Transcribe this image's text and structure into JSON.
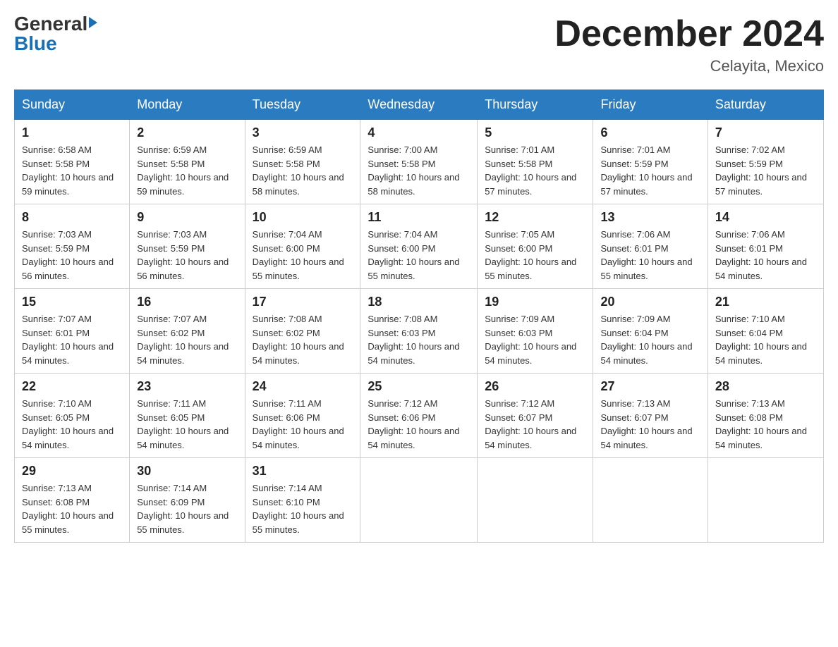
{
  "logo": {
    "general": "General",
    "blue": "Blue"
  },
  "title": {
    "month": "December 2024",
    "location": "Celayita, Mexico"
  },
  "weekdays": [
    "Sunday",
    "Monday",
    "Tuesday",
    "Wednesday",
    "Thursday",
    "Friday",
    "Saturday"
  ],
  "weeks": [
    [
      {
        "day": "1",
        "sunrise": "6:58 AM",
        "sunset": "5:58 PM",
        "daylight": "10 hours and 59 minutes."
      },
      {
        "day": "2",
        "sunrise": "6:59 AM",
        "sunset": "5:58 PM",
        "daylight": "10 hours and 59 minutes."
      },
      {
        "day": "3",
        "sunrise": "6:59 AM",
        "sunset": "5:58 PM",
        "daylight": "10 hours and 58 minutes."
      },
      {
        "day": "4",
        "sunrise": "7:00 AM",
        "sunset": "5:58 PM",
        "daylight": "10 hours and 58 minutes."
      },
      {
        "day": "5",
        "sunrise": "7:01 AM",
        "sunset": "5:58 PM",
        "daylight": "10 hours and 57 minutes."
      },
      {
        "day": "6",
        "sunrise": "7:01 AM",
        "sunset": "5:59 PM",
        "daylight": "10 hours and 57 minutes."
      },
      {
        "day": "7",
        "sunrise": "7:02 AM",
        "sunset": "5:59 PM",
        "daylight": "10 hours and 57 minutes."
      }
    ],
    [
      {
        "day": "8",
        "sunrise": "7:03 AM",
        "sunset": "5:59 PM",
        "daylight": "10 hours and 56 minutes."
      },
      {
        "day": "9",
        "sunrise": "7:03 AM",
        "sunset": "5:59 PM",
        "daylight": "10 hours and 56 minutes."
      },
      {
        "day": "10",
        "sunrise": "7:04 AM",
        "sunset": "6:00 PM",
        "daylight": "10 hours and 55 minutes."
      },
      {
        "day": "11",
        "sunrise": "7:04 AM",
        "sunset": "6:00 PM",
        "daylight": "10 hours and 55 minutes."
      },
      {
        "day": "12",
        "sunrise": "7:05 AM",
        "sunset": "6:00 PM",
        "daylight": "10 hours and 55 minutes."
      },
      {
        "day": "13",
        "sunrise": "7:06 AM",
        "sunset": "6:01 PM",
        "daylight": "10 hours and 55 minutes."
      },
      {
        "day": "14",
        "sunrise": "7:06 AM",
        "sunset": "6:01 PM",
        "daylight": "10 hours and 54 minutes."
      }
    ],
    [
      {
        "day": "15",
        "sunrise": "7:07 AM",
        "sunset": "6:01 PM",
        "daylight": "10 hours and 54 minutes."
      },
      {
        "day": "16",
        "sunrise": "7:07 AM",
        "sunset": "6:02 PM",
        "daylight": "10 hours and 54 minutes."
      },
      {
        "day": "17",
        "sunrise": "7:08 AM",
        "sunset": "6:02 PM",
        "daylight": "10 hours and 54 minutes."
      },
      {
        "day": "18",
        "sunrise": "7:08 AM",
        "sunset": "6:03 PM",
        "daylight": "10 hours and 54 minutes."
      },
      {
        "day": "19",
        "sunrise": "7:09 AM",
        "sunset": "6:03 PM",
        "daylight": "10 hours and 54 minutes."
      },
      {
        "day": "20",
        "sunrise": "7:09 AM",
        "sunset": "6:04 PM",
        "daylight": "10 hours and 54 minutes."
      },
      {
        "day": "21",
        "sunrise": "7:10 AM",
        "sunset": "6:04 PM",
        "daylight": "10 hours and 54 minutes."
      }
    ],
    [
      {
        "day": "22",
        "sunrise": "7:10 AM",
        "sunset": "6:05 PM",
        "daylight": "10 hours and 54 minutes."
      },
      {
        "day": "23",
        "sunrise": "7:11 AM",
        "sunset": "6:05 PM",
        "daylight": "10 hours and 54 minutes."
      },
      {
        "day": "24",
        "sunrise": "7:11 AM",
        "sunset": "6:06 PM",
        "daylight": "10 hours and 54 minutes."
      },
      {
        "day": "25",
        "sunrise": "7:12 AM",
        "sunset": "6:06 PM",
        "daylight": "10 hours and 54 minutes."
      },
      {
        "day": "26",
        "sunrise": "7:12 AM",
        "sunset": "6:07 PM",
        "daylight": "10 hours and 54 minutes."
      },
      {
        "day": "27",
        "sunrise": "7:13 AM",
        "sunset": "6:07 PM",
        "daylight": "10 hours and 54 minutes."
      },
      {
        "day": "28",
        "sunrise": "7:13 AM",
        "sunset": "6:08 PM",
        "daylight": "10 hours and 54 minutes."
      }
    ],
    [
      {
        "day": "29",
        "sunrise": "7:13 AM",
        "sunset": "6:08 PM",
        "daylight": "10 hours and 55 minutes."
      },
      {
        "day": "30",
        "sunrise": "7:14 AM",
        "sunset": "6:09 PM",
        "daylight": "10 hours and 55 minutes."
      },
      {
        "day": "31",
        "sunrise": "7:14 AM",
        "sunset": "6:10 PM",
        "daylight": "10 hours and 55 minutes."
      },
      null,
      null,
      null,
      null
    ]
  ]
}
